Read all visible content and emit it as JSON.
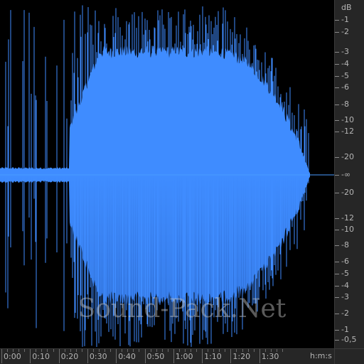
{
  "db_ruler": {
    "unit": "dB",
    "top_labels": [
      "-1",
      "-2",
      "-3",
      "-4",
      "-5",
      "-6",
      "-8",
      "-10",
      "-12",
      "-20"
    ],
    "center_label": "-∞",
    "bottom_labels": [
      "-20",
      "-12",
      "-10",
      "-8",
      "-6",
      "-5",
      "-4",
      "-3",
      "-2",
      "-1",
      "-0,5"
    ]
  },
  "time_ruler": {
    "labels": [
      "0:00",
      "0:10",
      "0:20",
      "0:30",
      "0:40",
      "0:50",
      "1:00",
      "1:10",
      "1:20",
      "1:30"
    ],
    "unit": "h:m:s"
  },
  "watermark": "Sound-Pack.Net",
  "colors": {
    "waveform": "#3f8cff",
    "waveform_dark": "#2f6fd6",
    "background": "#000000",
    "ruler": "#262626",
    "center_line": "#4a9bff"
  }
}
